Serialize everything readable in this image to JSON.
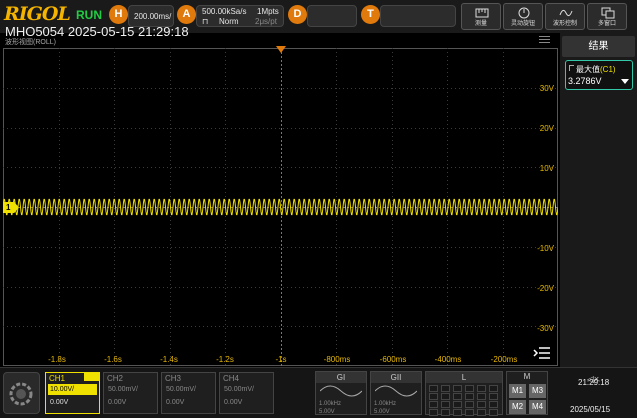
{
  "brand": "RIGOL",
  "run_status": "RUN",
  "horizontal": {
    "badge": "H",
    "timebase": "200.00ms/"
  },
  "acquisition": {
    "badge": "A",
    "sample_rate": "500.00kSa/s",
    "mode": "Norm",
    "memory_depth": "1Mpts",
    "time_per_point": "2μs/pt"
  },
  "display_badge": "D",
  "trigger_badge": "T",
  "toolbar": {
    "buttons": [
      {
        "label": "测量",
        "icon": "ruler-icon"
      },
      {
        "label": "灵动旋钮",
        "icon": "knob-icon"
      },
      {
        "label": "波形控制",
        "icon": "wave-control-icon"
      },
      {
        "label": "多窗口",
        "icon": "multi-window-icon"
      }
    ]
  },
  "waveform_title": "MHO5054 2025-05-15 21:29:18",
  "window_label": "波形视图(ROLL)",
  "voltage_axis": [
    "30V",
    "20V",
    "10V",
    "",
    "-10V",
    "-20V",
    "-30V"
  ],
  "time_axis": [
    "-1.8s",
    "-1.6s",
    "-1.4s",
    "-1.2s",
    "-1s",
    "-800ms",
    "-600ms",
    "-400ms",
    "-200ms"
  ],
  "channel_marker": "1",
  "results_panel": {
    "title": "结果",
    "measurement": {
      "name": "最大值",
      "channel": "(C1)",
      "value": "3.2786V"
    }
  },
  "channels": [
    {
      "name": "CH1",
      "scale": "10.00V/",
      "offset": "0.00V",
      "active": true
    },
    {
      "name": "CH2",
      "scale": "50.00mV/",
      "offset": "0.00V",
      "active": false
    },
    {
      "name": "CH3",
      "scale": "50.00mV/",
      "offset": "0.00V",
      "active": false
    },
    {
      "name": "CH4",
      "scale": "50.00mV/",
      "offset": "0.00V",
      "active": false
    }
  ],
  "generators": [
    {
      "name": "GI",
      "frequency": "1.00kHz",
      "amplitude": "5.00V"
    },
    {
      "name": "GII",
      "frequency": "1.00kHz",
      "amplitude": "5.00V"
    }
  ],
  "logic_panel": {
    "title": "L"
  },
  "math_panel": {
    "title": "M",
    "buttons": [
      "M1",
      "M3",
      "M2",
      "M4"
    ]
  },
  "clock": {
    "time": "21:29:18",
    "date": "2025/05/15"
  },
  "colors": {
    "ch1": "#f0e000",
    "accent": "#e07a0c",
    "run": "#22cc44",
    "measure_border": "#33c9a8"
  }
}
